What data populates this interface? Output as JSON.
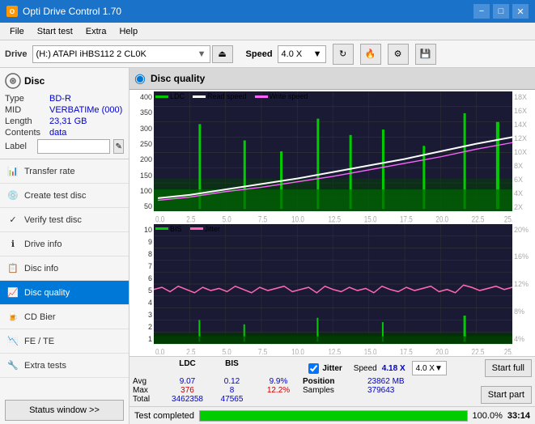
{
  "titlebar": {
    "icon": "O",
    "title": "Opti Drive Control 1.70",
    "minimize": "−",
    "maximize": "□",
    "close": "✕"
  },
  "menubar": {
    "items": [
      "File",
      "Start test",
      "Extra",
      "Help"
    ]
  },
  "drivebar": {
    "label": "Drive",
    "drive_value": "(H:) ATAPI iHBS112  2 CL0K",
    "speed_label": "Speed",
    "speed_value": "4.0 X"
  },
  "disc": {
    "header": "Disc",
    "type_label": "Type",
    "type_value": "BD-R",
    "mid_label": "MID",
    "mid_value": "VERBATIMe (000)",
    "length_label": "Length",
    "length_value": "23,31 GB",
    "contents_label": "Contents",
    "contents_value": "data",
    "label_label": "Label",
    "label_input": ""
  },
  "nav": {
    "items": [
      {
        "id": "transfer-rate",
        "label": "Transfer rate",
        "active": false
      },
      {
        "id": "create-test-disc",
        "label": "Create test disc",
        "active": false
      },
      {
        "id": "verify-test-disc",
        "label": "Verify test disc",
        "active": false
      },
      {
        "id": "drive-info",
        "label": "Drive info",
        "active": false
      },
      {
        "id": "disc-info",
        "label": "Disc info",
        "active": false
      },
      {
        "id": "disc-quality",
        "label": "Disc quality",
        "active": true
      },
      {
        "id": "cd-bier",
        "label": "CD Bier",
        "active": false
      },
      {
        "id": "fe-te",
        "label": "FE / TE",
        "active": false
      },
      {
        "id": "extra-tests",
        "label": "Extra tests",
        "active": false
      }
    ],
    "status_btn": "Status window >>"
  },
  "chart": {
    "title": "Disc quality",
    "legend_ldc": "LDC",
    "legend_read": "Read speed",
    "legend_write": "Write speed",
    "legend_bis": "BIS",
    "legend_jitter": "Jitter",
    "x_labels": [
      "0.0",
      "2.5",
      "5.0",
      "7.5",
      "10.0",
      "12.5",
      "15.0",
      "17.5",
      "20.0",
      "22.5",
      "25.0"
    ],
    "top_y_labels_left": [
      "400",
      "350",
      "300",
      "250",
      "200",
      "150",
      "100",
      "50"
    ],
    "top_y_labels_right": [
      "18X",
      "16X",
      "14X",
      "12X",
      "10X",
      "8X",
      "6X",
      "4X",
      "2X"
    ],
    "bottom_y_labels_left": [
      "10",
      "9",
      "8",
      "7",
      "6",
      "5",
      "4",
      "3",
      "2",
      "1"
    ],
    "bottom_y_labels_right": [
      "20%",
      "16%",
      "12%",
      "8%",
      "4%"
    ]
  },
  "stats": {
    "col_ldc": "LDC",
    "col_bis": "BIS",
    "col_jitter": "Jitter",
    "col_speed": "Speed",
    "col_position": "Position",
    "jitter_checked": true,
    "avg_label": "Avg",
    "avg_ldc": "9.07",
    "avg_bis": "0.12",
    "avg_jitter": "9.9%",
    "avg_speed": "4.18 X",
    "max_label": "Max",
    "max_ldc": "376",
    "max_bis": "8",
    "max_jitter": "12.2%",
    "max_speed": "4.0 X",
    "position_value": "23862 MB",
    "total_label": "Total",
    "total_ldc": "3462358",
    "total_bis": "47565",
    "samples_label": "Samples",
    "samples_value": "379643",
    "btn_start_full": "Start full",
    "btn_start_part": "Start part"
  },
  "bottom": {
    "status_text": "Test completed",
    "progress": 100,
    "time": "33:14"
  },
  "colors": {
    "accent": "#0078d7",
    "ldc_color": "#00aa00",
    "read_color": "#ffffff",
    "write_color": "#ff00ff",
    "bis_color": "#00aa00",
    "jitter_color": "#ff69b4",
    "bg_chart": "#1a1a35"
  }
}
